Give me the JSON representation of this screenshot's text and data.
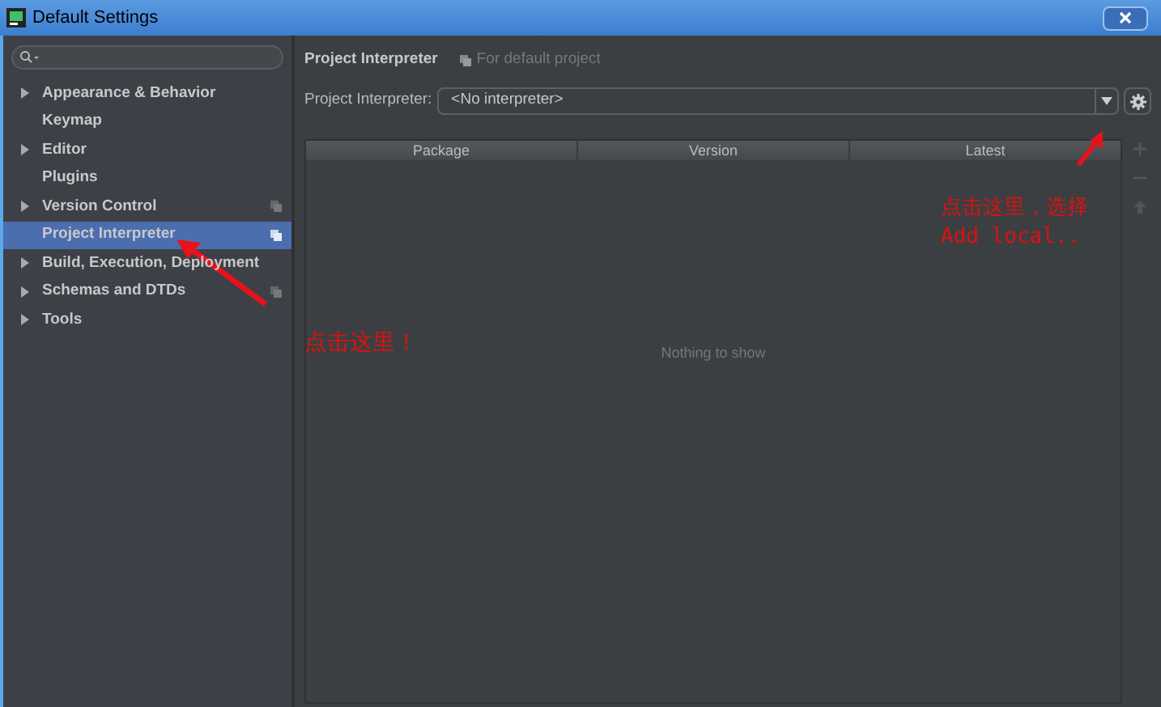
{
  "window": {
    "title": "Default Settings"
  },
  "sidebar": {
    "items": [
      {
        "label": "Appearance & Behavior",
        "expandable": true,
        "project_icon": false,
        "selected": false
      },
      {
        "label": "Keymap",
        "expandable": false,
        "project_icon": false,
        "selected": false
      },
      {
        "label": "Editor",
        "expandable": true,
        "project_icon": false,
        "selected": false
      },
      {
        "label": "Plugins",
        "expandable": false,
        "project_icon": false,
        "selected": false
      },
      {
        "label": "Version Control",
        "expandable": true,
        "project_icon": true,
        "selected": false
      },
      {
        "label": "Project Interpreter",
        "expandable": false,
        "project_icon": true,
        "selected": true
      },
      {
        "label": "Build, Execution, Deployment",
        "expandable": true,
        "project_icon": false,
        "selected": false
      },
      {
        "label": "Schemas and DTDs",
        "expandable": true,
        "project_icon": true,
        "selected": false
      },
      {
        "label": "Tools",
        "expandable": true,
        "project_icon": false,
        "selected": false
      }
    ]
  },
  "main": {
    "title": "Project Interpreter",
    "scope": "For default project",
    "interpreter_label": "Project Interpreter:",
    "interpreter_value": "<No interpreter>",
    "table": {
      "columns": [
        "Package",
        "Version",
        "Latest"
      ],
      "empty_text": "Nothing to show"
    }
  },
  "annotations": [
    {
      "lines": [
        "点击这里！"
      ]
    },
    {
      "lines": [
        "点击这里，选择",
        "Add local.."
      ]
    }
  ]
}
